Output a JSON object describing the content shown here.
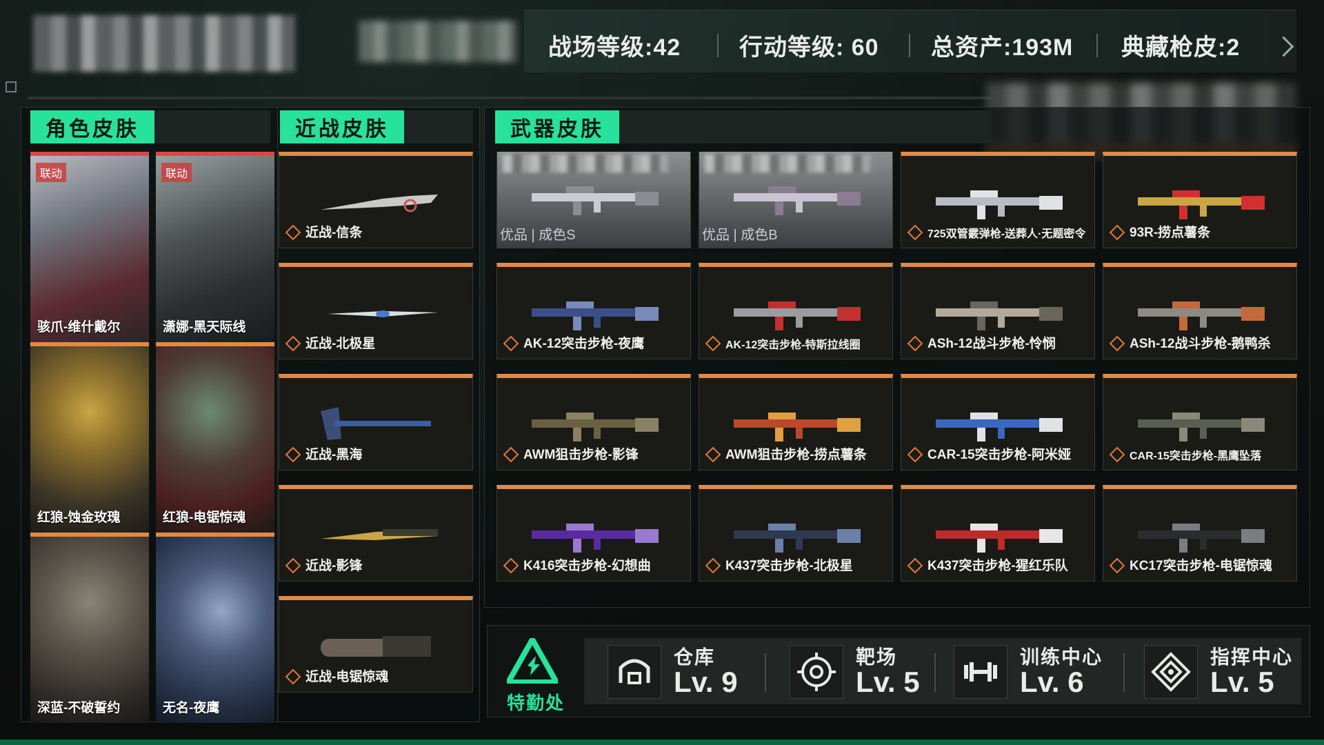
{
  "header": {
    "stats": [
      {
        "label": "战场等级:42"
      },
      {
        "label": "行动等级: 60"
      },
      {
        "label": "总资产:193M"
      },
      {
        "label": "典藏枪皮:2"
      }
    ]
  },
  "tabs": {
    "character": "角色皮肤",
    "melee": "近战皮肤",
    "weapon": "武器皮肤"
  },
  "character_skins": [
    {
      "name": "骇爪-维什戴尔",
      "badge": "联动"
    },
    {
      "name": "潇娜-黑天际线",
      "badge": "联动"
    },
    {
      "name": "红狼-蚀金玫瑰",
      "badge": ""
    },
    {
      "name": "红狼-电锯惊魂",
      "badge": ""
    },
    {
      "name": "深蓝-不破誓约",
      "badge": ""
    },
    {
      "name": "无名-夜鹰",
      "badge": ""
    }
  ],
  "melee_skins": [
    {
      "name": "近战-信条"
    },
    {
      "name": "近战-北极星"
    },
    {
      "name": "近战-黑海"
    },
    {
      "name": "近战-影锋"
    },
    {
      "name": "近战-电锯惊魂"
    }
  ],
  "weapon_skins": [
    {
      "name": "优品 | 成色S",
      "style": "gray"
    },
    {
      "name": "优品 | 成色B",
      "style": "gray"
    },
    {
      "name": "725双管霰弹枪-送葬人·无题密令",
      "style": "normal"
    },
    {
      "name": "93R-捞点薯条",
      "style": "normal"
    },
    {
      "name": "AK-12突击步枪-夜鹰",
      "style": "normal"
    },
    {
      "name": "AK-12突击步枪-特斯拉线圈",
      "style": "normal"
    },
    {
      "name": "ASh-12战斗步枪-怜悯",
      "style": "normal"
    },
    {
      "name": "ASh-12战斗步枪-鹅鸭杀",
      "style": "normal"
    },
    {
      "name": "AWM狙击步枪-影锋",
      "style": "normal"
    },
    {
      "name": "AWM狙击步枪-捞点薯条",
      "style": "normal"
    },
    {
      "name": "CAR-15突击步枪-阿米娅",
      "style": "normal"
    },
    {
      "name": "CAR-15突击步枪-黑鹰坠落",
      "style": "normal"
    },
    {
      "name": "K416突击步枪-幻想曲",
      "style": "normal"
    },
    {
      "name": "K437突击步枪-北极星",
      "style": "normal"
    },
    {
      "name": "K437突击步枪-猩红乐队",
      "style": "normal"
    },
    {
      "name": "KC17突击步枪-电锯惊魂",
      "style": "normal"
    }
  ],
  "special_office": {
    "title": "特勤处",
    "facilities": [
      {
        "name": "仓库",
        "level": "Lv. 9",
        "icon": "warehouse-icon"
      },
      {
        "name": "靶场",
        "level": "Lv. 5",
        "icon": "target-icon"
      },
      {
        "name": "训练中心",
        "level": "Lv. 6",
        "icon": "dumbbell-icon"
      },
      {
        "name": "指挥中心",
        "level": "Lv. 5",
        "icon": "command-icon"
      }
    ]
  },
  "colors": {
    "accent_green": "#26e29a",
    "card_top_orange": "#e08a45",
    "card_top_red": "#e04545"
  }
}
